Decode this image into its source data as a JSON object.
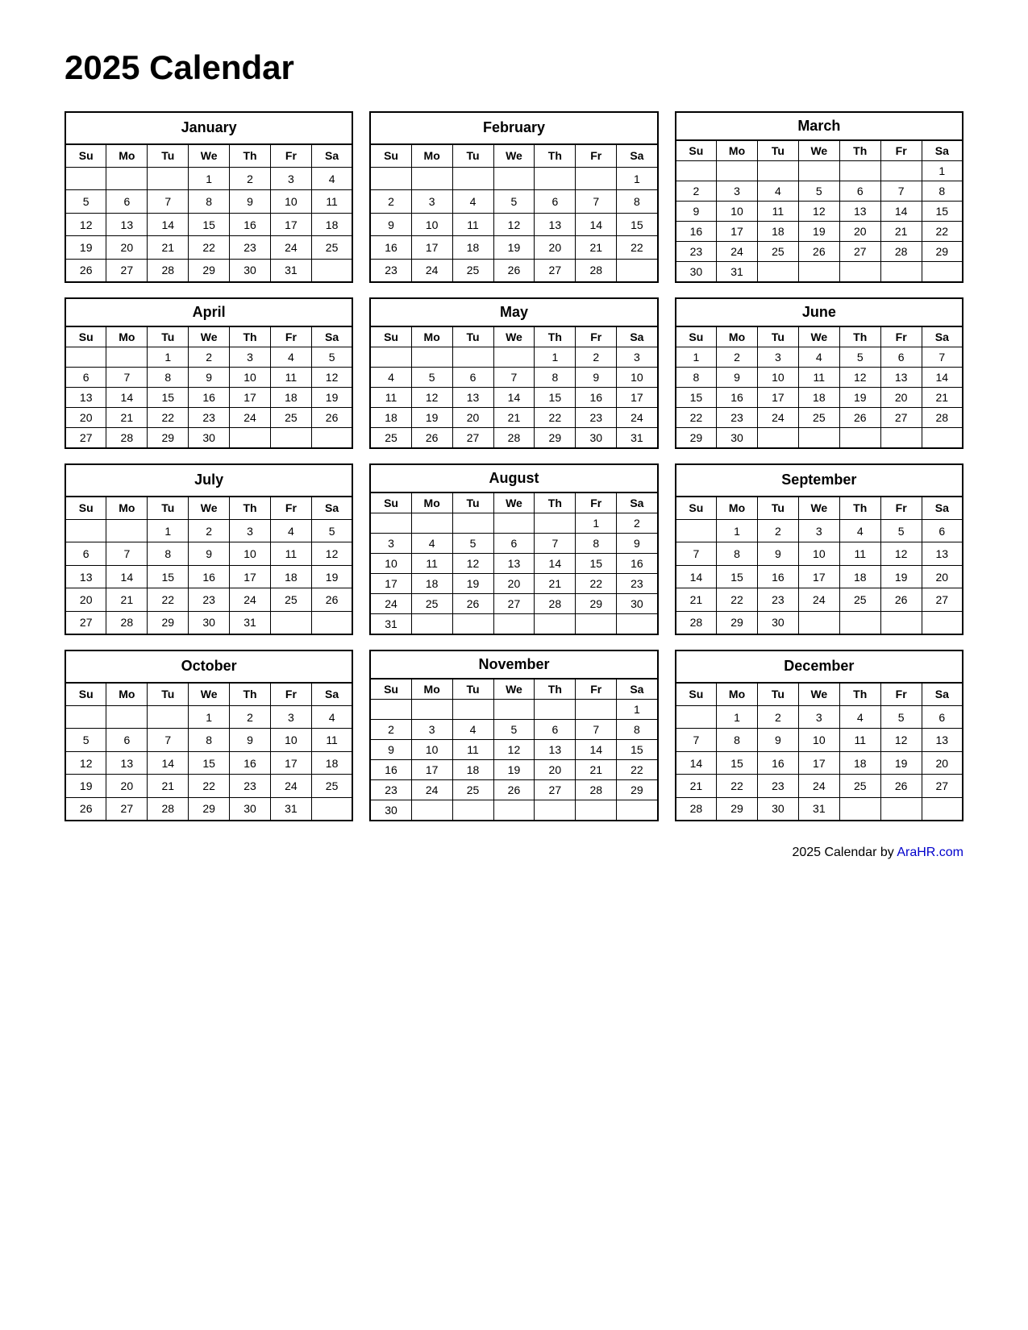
{
  "title": "2025 Calendar",
  "footer": {
    "text": "2025  Calendar by ",
    "link_label": "AraHR.com",
    "link_url": "https://arahr.com"
  },
  "months": [
    {
      "name": "January",
      "weeks": [
        [
          "",
          "",
          "",
          "1",
          "2",
          "3",
          "4"
        ],
        [
          "5",
          "6",
          "7",
          "8",
          "9",
          "10",
          "11"
        ],
        [
          "12",
          "13",
          "14",
          "15",
          "16",
          "17",
          "18"
        ],
        [
          "19",
          "20",
          "21",
          "22",
          "23",
          "24",
          "25"
        ],
        [
          "26",
          "27",
          "28",
          "29",
          "30",
          "31",
          ""
        ]
      ]
    },
    {
      "name": "February",
      "weeks": [
        [
          "",
          "",
          "",
          "",
          "",
          "",
          "1"
        ],
        [
          "2",
          "3",
          "4",
          "5",
          "6",
          "7",
          "8"
        ],
        [
          "9",
          "10",
          "11",
          "12",
          "13",
          "14",
          "15"
        ],
        [
          "16",
          "17",
          "18",
          "19",
          "20",
          "21",
          "22"
        ],
        [
          "23",
          "24",
          "25",
          "26",
          "27",
          "28",
          ""
        ]
      ]
    },
    {
      "name": "March",
      "weeks": [
        [
          "",
          "",
          "",
          "",
          "",
          "",
          "1"
        ],
        [
          "2",
          "3",
          "4",
          "5",
          "6",
          "7",
          "8"
        ],
        [
          "9",
          "10",
          "11",
          "12",
          "13",
          "14",
          "15"
        ],
        [
          "16",
          "17",
          "18",
          "19",
          "20",
          "21",
          "22"
        ],
        [
          "23",
          "24",
          "25",
          "26",
          "27",
          "28",
          "29"
        ],
        [
          "30",
          "31",
          "",
          "",
          "",
          "",
          ""
        ]
      ]
    },
    {
      "name": "April",
      "weeks": [
        [
          "",
          "",
          "1",
          "2",
          "3",
          "4",
          "5"
        ],
        [
          "6",
          "7",
          "8",
          "9",
          "10",
          "11",
          "12"
        ],
        [
          "13",
          "14",
          "15",
          "16",
          "17",
          "18",
          "19"
        ],
        [
          "20",
          "21",
          "22",
          "23",
          "24",
          "25",
          "26"
        ],
        [
          "27",
          "28",
          "29",
          "30",
          "",
          "",
          ""
        ]
      ]
    },
    {
      "name": "May",
      "weeks": [
        [
          "",
          "",
          "",
          "",
          "1",
          "2",
          "3"
        ],
        [
          "4",
          "5",
          "6",
          "7",
          "8",
          "9",
          "10"
        ],
        [
          "11",
          "12",
          "13",
          "14",
          "15",
          "16",
          "17"
        ],
        [
          "18",
          "19",
          "20",
          "21",
          "22",
          "23",
          "24"
        ],
        [
          "25",
          "26",
          "27",
          "28",
          "29",
          "30",
          "31"
        ]
      ]
    },
    {
      "name": "June",
      "weeks": [
        [
          "1",
          "2",
          "3",
          "4",
          "5",
          "6",
          "7"
        ],
        [
          "8",
          "9",
          "10",
          "11",
          "12",
          "13",
          "14"
        ],
        [
          "15",
          "16",
          "17",
          "18",
          "19",
          "20",
          "21"
        ],
        [
          "22",
          "23",
          "24",
          "25",
          "26",
          "27",
          "28"
        ],
        [
          "29",
          "30",
          "",
          "",
          "",
          "",
          ""
        ]
      ]
    },
    {
      "name": "July",
      "weeks": [
        [
          "",
          "",
          "1",
          "2",
          "3",
          "4",
          "5"
        ],
        [
          "6",
          "7",
          "8",
          "9",
          "10",
          "11",
          "12"
        ],
        [
          "13",
          "14",
          "15",
          "16",
          "17",
          "18",
          "19"
        ],
        [
          "20",
          "21",
          "22",
          "23",
          "24",
          "25",
          "26"
        ],
        [
          "27",
          "28",
          "29",
          "30",
          "31",
          "",
          ""
        ]
      ]
    },
    {
      "name": "August",
      "weeks": [
        [
          "",
          "",
          "",
          "",
          "",
          "1",
          "2"
        ],
        [
          "3",
          "4",
          "5",
          "6",
          "7",
          "8",
          "9"
        ],
        [
          "10",
          "11",
          "12",
          "13",
          "14",
          "15",
          "16"
        ],
        [
          "17",
          "18",
          "19",
          "20",
          "21",
          "22",
          "23"
        ],
        [
          "24",
          "25",
          "26",
          "27",
          "28",
          "29",
          "30"
        ],
        [
          "31",
          "",
          "",
          "",
          "",
          "",
          ""
        ]
      ]
    },
    {
      "name": "September",
      "weeks": [
        [
          "",
          "1",
          "2",
          "3",
          "4",
          "5",
          "6"
        ],
        [
          "7",
          "8",
          "9",
          "10",
          "11",
          "12",
          "13"
        ],
        [
          "14",
          "15",
          "16",
          "17",
          "18",
          "19",
          "20"
        ],
        [
          "21",
          "22",
          "23",
          "24",
          "25",
          "26",
          "27"
        ],
        [
          "28",
          "29",
          "30",
          "",
          "",
          "",
          ""
        ]
      ]
    },
    {
      "name": "October",
      "weeks": [
        [
          "",
          "",
          "",
          "1",
          "2",
          "3",
          "4"
        ],
        [
          "5",
          "6",
          "7",
          "8",
          "9",
          "10",
          "11"
        ],
        [
          "12",
          "13",
          "14",
          "15",
          "16",
          "17",
          "18"
        ],
        [
          "19",
          "20",
          "21",
          "22",
          "23",
          "24",
          "25"
        ],
        [
          "26",
          "27",
          "28",
          "29",
          "30",
          "31",
          ""
        ]
      ]
    },
    {
      "name": "November",
      "weeks": [
        [
          "",
          "",
          "",
          "",
          "",
          "",
          "1"
        ],
        [
          "2",
          "3",
          "4",
          "5",
          "6",
          "7",
          "8"
        ],
        [
          "9",
          "10",
          "11",
          "12",
          "13",
          "14",
          "15"
        ],
        [
          "16",
          "17",
          "18",
          "19",
          "20",
          "21",
          "22"
        ],
        [
          "23",
          "24",
          "25",
          "26",
          "27",
          "28",
          "29"
        ],
        [
          "30",
          "",
          "",
          "",
          "",
          "",
          ""
        ]
      ]
    },
    {
      "name": "December",
      "weeks": [
        [
          "",
          "1",
          "2",
          "3",
          "4",
          "5",
          "6"
        ],
        [
          "7",
          "8",
          "9",
          "10",
          "11",
          "12",
          "13"
        ],
        [
          "14",
          "15",
          "16",
          "17",
          "18",
          "19",
          "20"
        ],
        [
          "21",
          "22",
          "23",
          "24",
          "25",
          "26",
          "27"
        ],
        [
          "28",
          "29",
          "30",
          "31",
          "",
          "",
          ""
        ]
      ]
    }
  ],
  "day_headers": [
    "Su",
    "Mo",
    "Tu",
    "We",
    "Th",
    "Fr",
    "Sa"
  ]
}
